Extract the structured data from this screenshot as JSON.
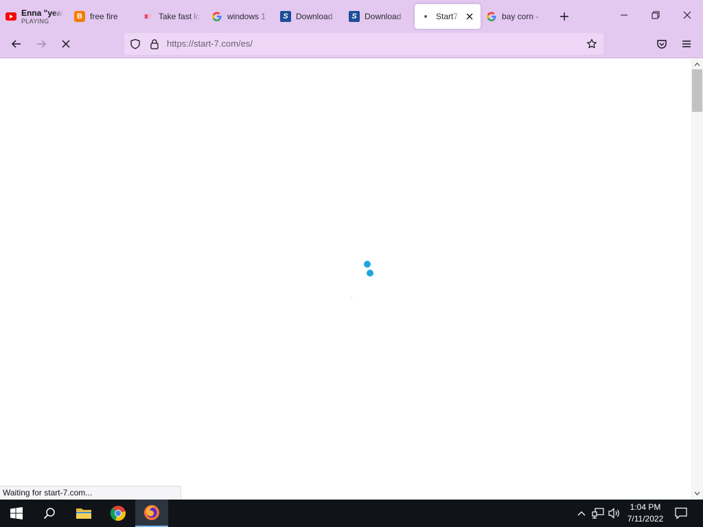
{
  "browser": {
    "tabs": [
      {
        "title": "Enna \"yeah",
        "subtitle": "PLAYING",
        "icon": "youtube-icon",
        "active": false
      },
      {
        "title": "free fire",
        "icon": "blogger-icon",
        "active": false
      },
      {
        "title": "Take fast lc",
        "icon": "image-favicon-icon",
        "active": false
      },
      {
        "title": "windows 1",
        "icon": "google-icon",
        "active": false
      },
      {
        "title": "Download",
        "icon": "download-site-icon",
        "active": false
      },
      {
        "title": "Download",
        "icon": "download-site-icon",
        "active": false
      },
      {
        "title": "Start7 -",
        "icon": "loading-dot-icon",
        "active": true
      },
      {
        "title": "bay corn -",
        "icon": "google-icon",
        "active": false
      }
    ],
    "url": "https://start-7.com/es/",
    "status_text": "Waiting for start-7.com...",
    "colors": {
      "chrome": "#e3c8f0",
      "urlbar": "#eed7f6",
      "spinner": "#1fa6e0"
    }
  },
  "taskbar": {
    "time": "1:04 PM",
    "date": "7/11/2022",
    "apps": [
      "start-icon",
      "search-icon",
      "file-explorer-icon",
      "chrome-icon",
      "firefox-icon"
    ]
  }
}
